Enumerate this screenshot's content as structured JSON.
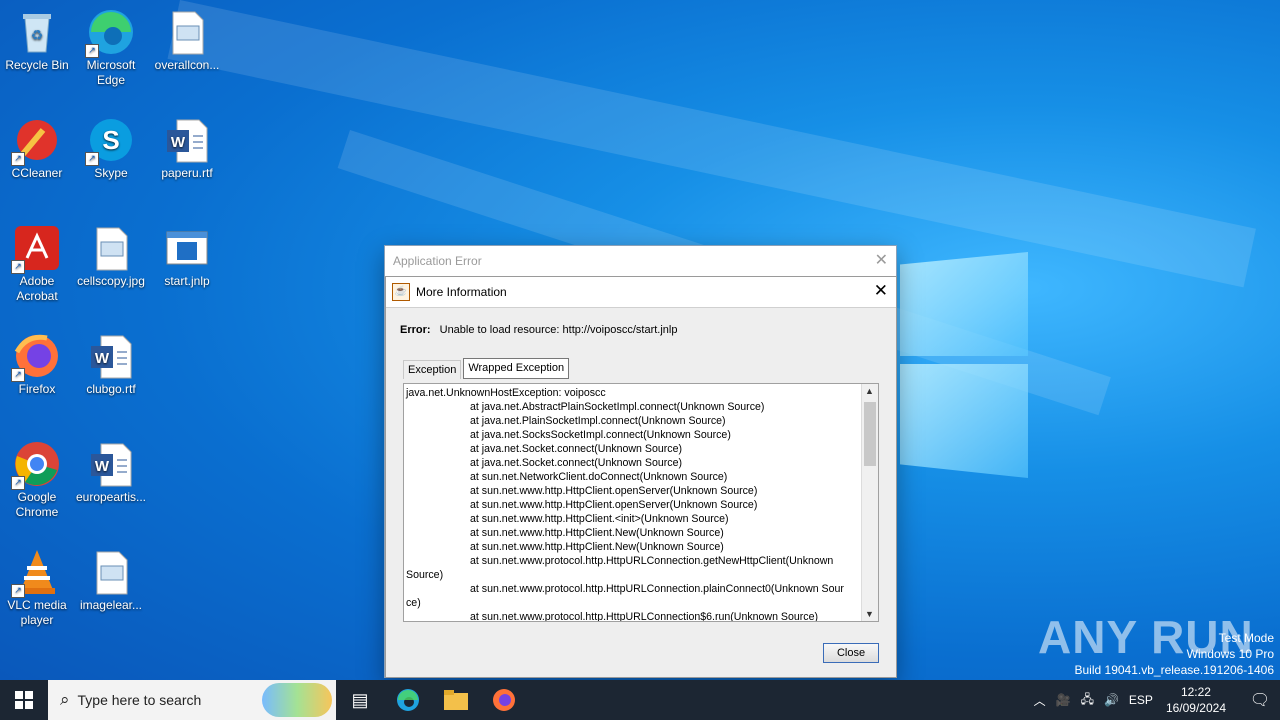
{
  "desktop": {
    "icons": [
      {
        "label": "Recycle Bin",
        "icon": "recycle-bin-icon"
      },
      {
        "label": "Microsoft Edge",
        "icon": "edge-icon"
      },
      {
        "label": "overallcon...",
        "icon": "image-file-icon"
      },
      {
        "label": "CCleaner",
        "icon": "ccleaner-icon"
      },
      {
        "label": "Skype",
        "icon": "skype-icon"
      },
      {
        "label": "paperu.rtf",
        "icon": "word-doc-icon"
      },
      {
        "label": "Adobe Acrobat",
        "icon": "acrobat-icon"
      },
      {
        "label": "cellscopy.jpg",
        "icon": "image-file-icon"
      },
      {
        "label": "start.jnlp",
        "icon": "jnlp-file-icon"
      },
      {
        "label": "Firefox",
        "icon": "firefox-icon"
      },
      {
        "label": "clubgo.rtf",
        "icon": "word-doc-icon"
      },
      {
        "label": "Google Chrome",
        "icon": "chrome-icon"
      },
      {
        "label": "europeartis...",
        "icon": "word-doc-icon"
      },
      {
        "label": "VLC media player",
        "icon": "vlc-icon"
      },
      {
        "label": "imagelear...",
        "icon": "image-file-icon"
      }
    ]
  },
  "back_dialog": {
    "title": "Application Error"
  },
  "dialog": {
    "title": "More Information",
    "error_label": "Error:",
    "error_message": "Unable to load resource: http://voiposcc/start.jnlp",
    "tabs": [
      "Exception",
      "Wrapped Exception"
    ],
    "active_tab": "Wrapped Exception",
    "trace_lines": [
      "java.net.UnknownHostException: voiposcc",
      "\t\tat java.net.AbstractPlainSocketImpl.connect(Unknown Source)",
      "\t\tat java.net.PlainSocketImpl.connect(Unknown Source)",
      "\t\tat java.net.SocksSocketImpl.connect(Unknown Source)",
      "\t\tat java.net.Socket.connect(Unknown Source)",
      "\t\tat java.net.Socket.connect(Unknown Source)",
      "\t\tat sun.net.NetworkClient.doConnect(Unknown Source)",
      "\t\tat sun.net.www.http.HttpClient.openServer(Unknown Source)",
      "\t\tat sun.net.www.http.HttpClient.openServer(Unknown Source)",
      "\t\tat sun.net.www.http.HttpClient.<init>(Unknown Source)",
      "\t\tat sun.net.www.http.HttpClient.New(Unknown Source)",
      "\t\tat sun.net.www.http.HttpClient.New(Unknown Source)",
      "\t\tat sun.net.www.protocol.http.HttpURLConnection.getNewHttpClient(Unknown",
      "Source)",
      "\t\tat sun.net.www.protocol.http.HttpURLConnection.plainConnect0(Unknown Sour",
      "ce)",
      "\t\tat sun.net.www.protocol.http.HttpURLConnection$6.run(Unknown Source)"
    ],
    "close_label": "Close"
  },
  "watermark": {
    "logo_text": "ANY RUN",
    "line1": "Test Mode",
    "line2": "Windows 10 Pro",
    "line3": "Build 19041.vb_release.191206-1406"
  },
  "taskbar": {
    "search_placeholder": "Type here to search",
    "language": "ESP",
    "time": "12:22",
    "date": "16/09/2024"
  }
}
